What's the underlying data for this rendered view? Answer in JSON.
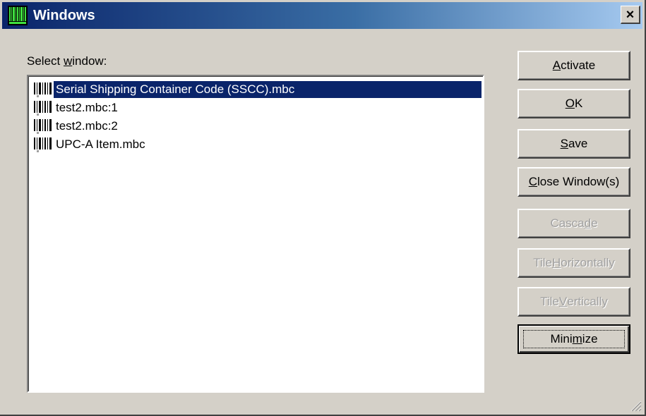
{
  "window": {
    "title": "Windows",
    "close_glyph": "×",
    "icon": "barcode-icon"
  },
  "select_label": {
    "before": "Select ",
    "accel": "w",
    "after": "indow:"
  },
  "list": {
    "selected_index": 0,
    "selected_color": "#0a246a",
    "items": [
      {
        "label": "Serial Shipping Container Code (SSCC).mbc",
        "icon": "barcode-doc-icon"
      },
      {
        "label": "test2.mbc:1",
        "icon": "barcode-doc-icon"
      },
      {
        "label": "test2.mbc:2",
        "icon": "barcode-doc-icon"
      },
      {
        "label": "UPC-A Item.mbc",
        "icon": "barcode-doc-icon"
      }
    ]
  },
  "buttons": {
    "activate": {
      "before": "",
      "accel": "A",
      "after": "ctivate",
      "enabled": true
    },
    "ok": {
      "before": "",
      "accel": "O",
      "after": "K",
      "enabled": true
    },
    "save": {
      "before": "",
      "accel": "S",
      "after": "ave",
      "enabled": true
    },
    "close_windows": {
      "before": "",
      "accel": "C",
      "after": "lose Window(s)",
      "enabled": true
    },
    "cascade": {
      "before": "Casca",
      "accel": "d",
      "after": "e",
      "enabled": false
    },
    "tile_horizontally": {
      "before": "Tile ",
      "accel": "H",
      "after": "orizontally",
      "enabled": false
    },
    "tile_vertically": {
      "before": "Tile ",
      "accel": "V",
      "after": "ertically",
      "enabled": false
    },
    "minimize": {
      "before": "Mini",
      "accel": "m",
      "after": "ize",
      "enabled": true,
      "focused": true
    }
  },
  "colors": {
    "face": "#d4d0c8",
    "title_start": "#0a246a",
    "title_end": "#a6caf0",
    "disabled_text": "#a0a0a0"
  }
}
